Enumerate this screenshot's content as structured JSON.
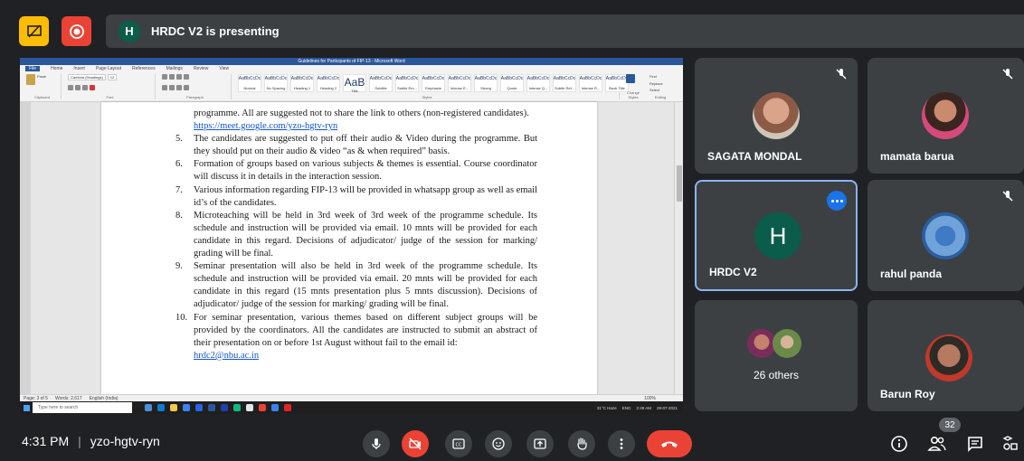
{
  "presenting": {
    "avatar_letter": "H",
    "text": "HRDC V2 is presenting"
  },
  "document": {
    "window_title": "Guidelines for Participants of FIP-13 - Microsoft Word",
    "tabs": [
      "File",
      "Home",
      "Insert",
      "Page Layout",
      "References",
      "Mailings",
      "Review",
      "View"
    ],
    "font_name": "Cambria (Headings)",
    "font_size": "12",
    "styles": [
      "Normal",
      "No Spacing",
      "Heading 1",
      "Heading 2",
      "Title",
      "Subtitle",
      "Subtle Em...",
      "Emphasis",
      "Intense E...",
      "Strong",
      "Quote",
      "Intense Q...",
      "Subtle Ref...",
      "Intense R...",
      "Book Title"
    ],
    "style_sample": "AaBbCcDc",
    "style_big_sample": "AaB",
    "ribbon_groups": [
      "Clipboard",
      "Font",
      "Paragraph",
      "Styles",
      "Editing"
    ],
    "paste_label": "Paste",
    "change_styles_label": "Change Styles",
    "find_label": "Find",
    "replace_label": "Replace",
    "select_label": "Select",
    "para_cont_1": "programme. All are suggested not to share the link to others (non-registered candidates).",
    "link": "https://meet.google.com/yzo-hgtv-ryn",
    "items": [
      {
        "num": "5.",
        "text": "The candidates are suggested to put off their audio & Video during the programme. But they should put on their audio & video “as & when required” basis."
      },
      {
        "num": "6.",
        "text": "Formation of groups based on various subjects & themes is essential. Course coordinator will discuss it in details in the interaction session."
      },
      {
        "num": "7.",
        "text": "Various information regarding FIP-13 will be provided in whatsapp group as well as email id’s of the candidates."
      },
      {
        "num": "8.",
        "text": "Microteaching will be held in 3rd week of 3rd week of the programme schedule. Its schedule and instruction will be provided via email. 10 mnts will be provided for each candidate in this regard. Decisions of adjudicator/ judge of the session for marking/ grading will be final."
      },
      {
        "num": "9.",
        "text": "Seminar presentation will also be held in 3rd week of the programme schedule. Its schedule and instruction will be provided via email. 20 mnts will be provided for each candidate in this regard (15 mnts presentation plus 5 mnts discussion). Decisions of adjudicator/ judge of the session for marking/ grading will be final."
      },
      {
        "num": "10.",
        "text": "For seminar presentation, various themes based on different subject groups will be provided by the coordinators. All the candidates are instructed to submit an abstract of their presentation on or before 1st August without fail to the email id:"
      }
    ],
    "email": "hrdc2@nbu.ac.in",
    "status_page": "Page: 3 of 5",
    "status_words": "Words: 2,617",
    "status_language": "English (India)",
    "taskbar_search": "Type here to search",
    "tray_weather": "31°C Haze",
    "tray_lang": "ENG",
    "tray_time": "2:49 AM",
    "tray_date": "29-07-2021",
    "zoom": "100%"
  },
  "participants": [
    {
      "name": "SAGATA MONDAL",
      "muted": true
    },
    {
      "name": "mamata barua",
      "muted": true
    },
    {
      "name": "HRDC V2",
      "avatar_letter": "H",
      "pinned": true
    },
    {
      "name": "rahul panda",
      "muted": true
    },
    {
      "name": "Barun Roy",
      "muted": false
    }
  ],
  "others": {
    "label": "26 others"
  },
  "meeting": {
    "time": "4:31 PM",
    "separator": "|",
    "code": "yzo-hgtv-ryn",
    "participant_count": "32"
  },
  "colors": {
    "background": "#202124",
    "tile": "#3c4043",
    "accent_blue": "#1a73e8",
    "danger_red": "#ea4335",
    "present_yellow": "#fbbc04",
    "avatar_green": "#0b5c4a"
  }
}
